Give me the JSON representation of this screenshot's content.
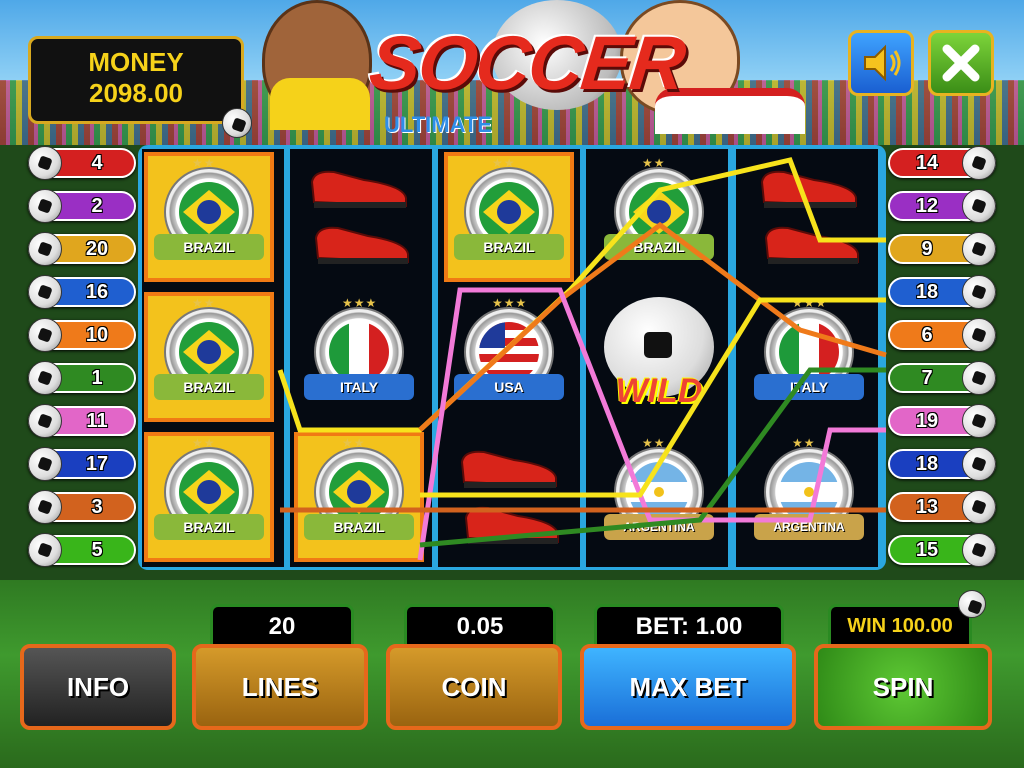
{
  "money": {
    "label": "MONEY",
    "value": "2098.00"
  },
  "logo": {
    "title": "SOCCER",
    "subtitle": "ULTIMATE"
  },
  "left_lines": [
    {
      "num": "4",
      "color": "#d42020"
    },
    {
      "num": "2",
      "color": "#9a2fc4"
    },
    {
      "num": "20",
      "color": "#e0a61e"
    },
    {
      "num": "16",
      "color": "#1f5fd0"
    },
    {
      "num": "10",
      "color": "#ef7a1a"
    },
    {
      "num": "1",
      "color": "#2f8a22"
    },
    {
      "num": "11",
      "color": "#e266c8"
    },
    {
      "num": "17",
      "color": "#1a3fc0"
    },
    {
      "num": "3",
      "color": "#d2621e"
    },
    {
      "num": "5",
      "color": "#39b51a"
    }
  ],
  "right_lines": [
    {
      "num": "14",
      "color": "#d42020"
    },
    {
      "num": "12",
      "color": "#9a2fc4"
    },
    {
      "num": "9",
      "color": "#e0a61e"
    },
    {
      "num": "18",
      "color": "#1f5fd0"
    },
    {
      "num": "6",
      "color": "#ef7a1a"
    },
    {
      "num": "7",
      "color": "#2f8a22"
    },
    {
      "num": "19",
      "color": "#e266c8"
    },
    {
      "num": "18",
      "color": "#1a3fc0"
    },
    {
      "num": "13",
      "color": "#d2621e"
    },
    {
      "num": "15",
      "color": "#39b51a"
    }
  ],
  "symbols": {
    "brazil": "BRAZIL",
    "italy": "ITALY",
    "usa": "USA",
    "argentina": "ARGENTINA",
    "wild": "WILD"
  },
  "controls": {
    "info": "INFO",
    "lines": "LINES",
    "lines_value": "20",
    "coin": "COIN",
    "coin_value": "0.05",
    "max_bet": "MAX BET",
    "bet_display": "BET: 1.00",
    "spin": "SPIN",
    "win_display": "WIN 100.00"
  },
  "colors": {
    "accent": "#e6681b",
    "frame": "#2aa7e0",
    "money": "#f6d21a"
  }
}
